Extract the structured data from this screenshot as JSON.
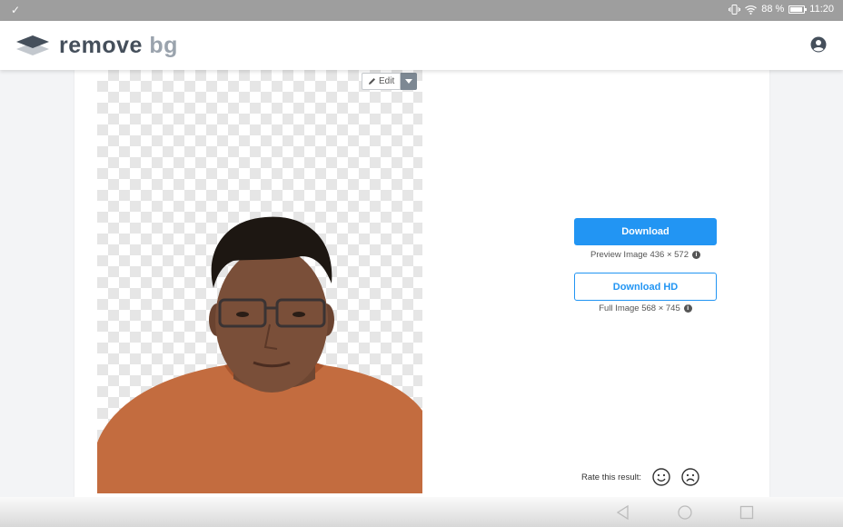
{
  "status_bar": {
    "check_glyph": "✓",
    "battery_percent": "88 %",
    "battery_level": 0.88,
    "time": "11:20"
  },
  "header": {
    "logo_part1": "remove",
    "logo_part2": "bg",
    "account_icon": "account-circle-icon"
  },
  "editor": {
    "edit_label": "Edit"
  },
  "download": {
    "label": "Download",
    "info": "Preview Image 436 × 572",
    "hd_label": "Download HD",
    "hd_info": "Full Image 568 × 745"
  },
  "rating": {
    "prompt": "Rate this result:"
  },
  "colors": {
    "accent": "#2295f3",
    "logo_dark": "#454f5b",
    "logo_light": "#9aa3ad"
  }
}
